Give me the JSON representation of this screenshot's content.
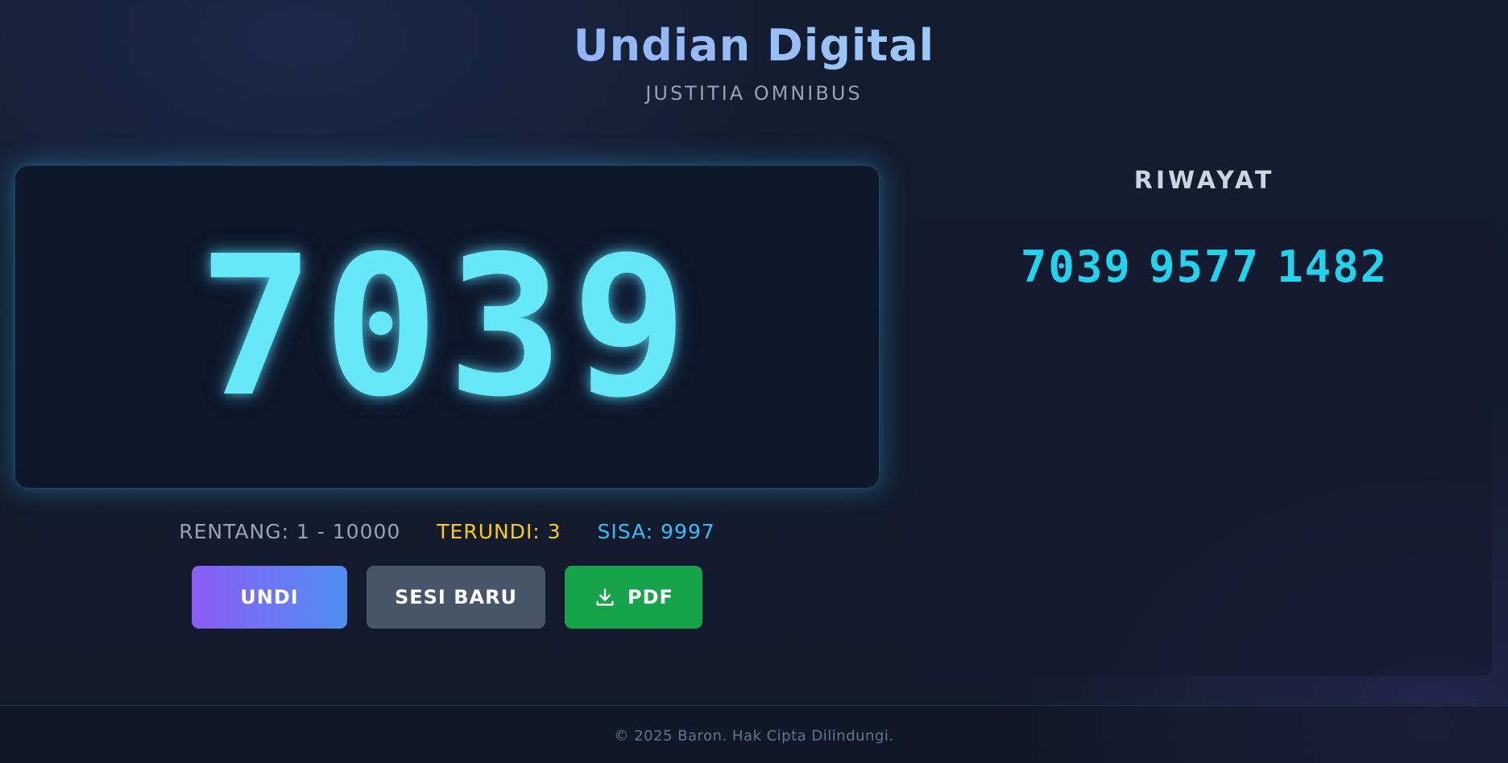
{
  "header": {
    "title": "Undian Digital",
    "subtitle": "JUSTITIA OMNIBUS"
  },
  "display": {
    "current_number": "7039"
  },
  "stats": {
    "range": "RENTANG: 1 - 10000",
    "drawn": "TERUNDI: 3",
    "remaining": "SISA: 9997"
  },
  "buttons": {
    "draw_label": "UNDI",
    "new_session_label": "SESI BARU",
    "pdf_label": "PDF",
    "pdf_icon": "download-icon"
  },
  "history": {
    "title": "RIWAYAT",
    "items": [
      "7039",
      "9577",
      "1482"
    ]
  },
  "footer": {
    "text": "© 2025 Baron. Hak Cipta Dilindungi."
  },
  "colors": {
    "accent_cyan": "#67e8f9",
    "drawn_yellow": "#facc15",
    "remaining_blue": "#38bdf8",
    "draw_gradient_start": "#8b5cf6",
    "draw_gradient_end": "#4f8ff0",
    "new_session_gray": "#475569",
    "pdf_green": "#16a34a"
  }
}
